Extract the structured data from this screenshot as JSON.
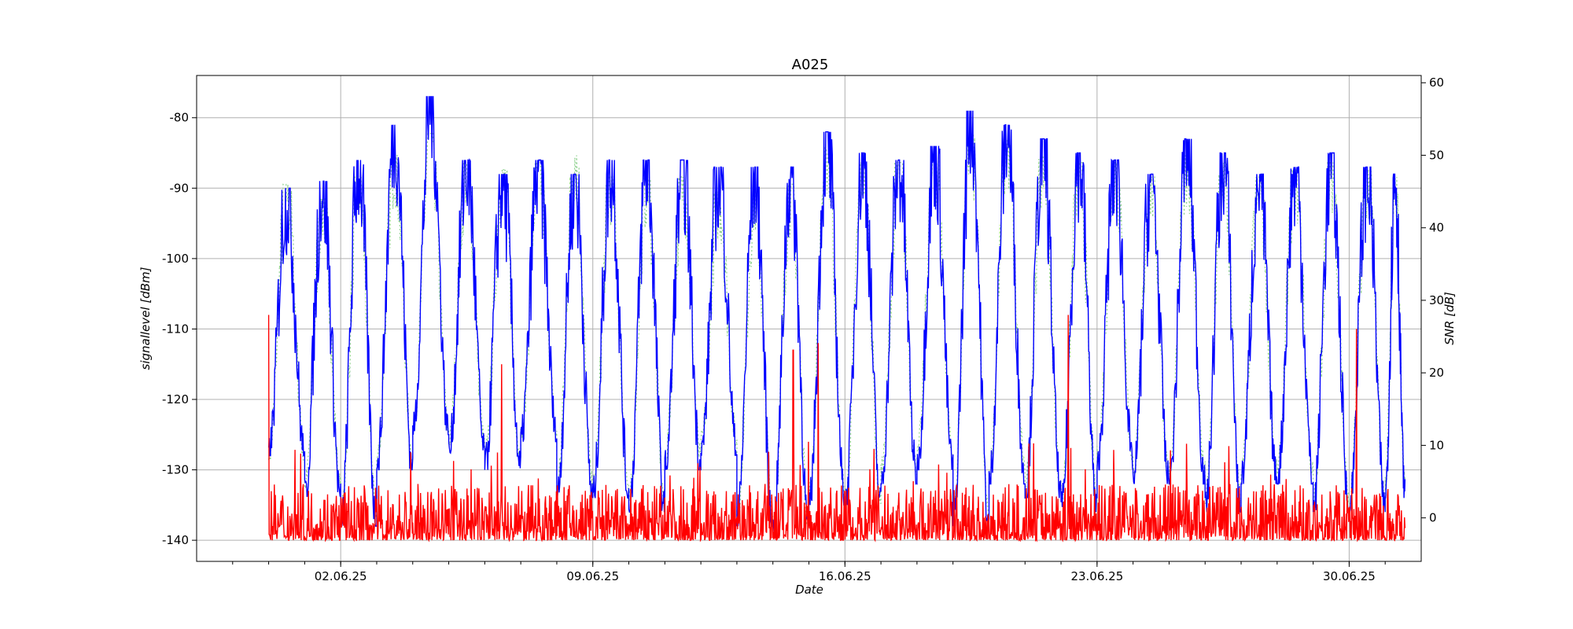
{
  "chart_data": {
    "type": "line",
    "title": "A025",
    "xlabel": "Date",
    "ylabel": "signallevel [dBm]",
    "y2label": "SNR [dB]",
    "x_ticks": [
      "02.06.25",
      "09.06.25",
      "16.06.25",
      "23.06.25",
      "30.06.25"
    ],
    "x_range": [
      "2025-05-29",
      "2025-07-02"
    ],
    "ylim": [
      -143,
      -74
    ],
    "y2lim": [
      -6,
      61
    ],
    "y_ticks": [
      -80,
      -90,
      -100,
      -110,
      -120,
      -130,
      -140
    ],
    "y2_ticks": [
      60,
      50,
      40,
      30,
      20,
      10,
      0
    ],
    "grid": true,
    "colors": {
      "signal": "#0000ff",
      "noise": "#ff0000",
      "snr": "#8fd18f",
      "grid": "#b0b0b0"
    },
    "series": [
      {
        "axis": "left",
        "color": "#0000ff",
        "x_dates": [
          "2025-05-31",
          "2025-06-01",
          "2025-06-02",
          "2025-06-03",
          "2025-06-04",
          "2025-06-05",
          "2025-06-06",
          "2025-06-07",
          "2025-06-08",
          "2025-06-09",
          "2025-06-10",
          "2025-06-11",
          "2025-06-12",
          "2025-06-13",
          "2025-06-14",
          "2025-06-15",
          "2025-06-16",
          "2025-06-17",
          "2025-06-18",
          "2025-06-19",
          "2025-06-20",
          "2025-06-21",
          "2025-06-22",
          "2025-06-23",
          "2025-06-24",
          "2025-06-25",
          "2025-06-26",
          "2025-06-27",
          "2025-06-28",
          "2025-06-29",
          "2025-06-30",
          "2025-07-01"
        ],
        "daily_max": [
          -90,
          -89,
          -86,
          -81,
          -77,
          -86,
          -88,
          -86,
          -88,
          -86,
          -86,
          -86,
          -87,
          -87,
          -87,
          -82,
          -85,
          -86,
          -84,
          -79,
          -81,
          -83,
          -85,
          -86,
          -88,
          -83,
          -85,
          -88,
          -87,
          -85,
          -87,
          -88
        ],
        "daily_min": [
          -128,
          -134,
          -138,
          -130,
          -125,
          -128,
          -130,
          -126,
          -134,
          -134,
          -136,
          -130,
          -128,
          -138,
          -139,
          -135,
          -135,
          -132,
          -130,
          -138,
          -132,
          -134,
          -136,
          -130,
          -132,
          -132,
          -136,
          -132,
          -132,
          -136,
          -136,
          -134
        ]
      },
      {
        "axis": "left",
        "color": "#ff0000",
        "baseline_range": [
          -140,
          -132
        ],
        "spikes": [
          {
            "date": "2025-05-31",
            "value": -108
          },
          {
            "date": "2025-06-06",
            "value": -115
          },
          {
            "date": "2025-06-14",
            "value": -113
          },
          {
            "date": "2025-06-15",
            "value": -112
          },
          {
            "date": "2025-06-22",
            "value": -108
          },
          {
            "date": "2025-06-30",
            "value": -110
          }
        ]
      },
      {
        "axis": "right",
        "color": "#8fd18f",
        "style": "dotted",
        "daily_max": [
          46,
          44,
          47,
          50,
          53,
          49,
          48,
          49,
          50,
          47,
          47,
          47,
          45,
          45,
          46,
          51,
          49,
          49,
          50,
          53,
          52,
          50,
          49,
          49,
          47,
          50,
          49,
          47,
          48,
          49,
          48,
          47
        ],
        "daily_min": [
          8,
          4,
          0,
          8,
          12,
          10,
          8,
          11,
          4,
          4,
          2,
          8,
          10,
          0,
          -1,
          3,
          2,
          6,
          8,
          0,
          6,
          4,
          2,
          8,
          6,
          6,
          2,
          6,
          6,
          2,
          2,
          4
        ]
      }
    ]
  }
}
